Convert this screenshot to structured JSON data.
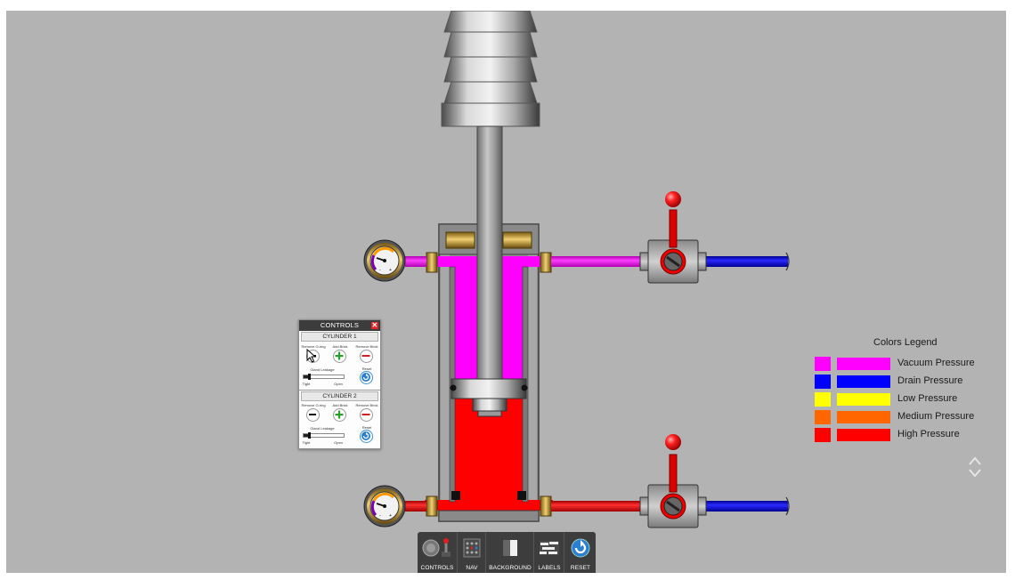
{
  "controls": {
    "title": "CONTROLS",
    "close_label": "✕",
    "cylinders": [
      {
        "title": "CYLINDER 1",
        "remove_oring_label": "Remove O-ring",
        "add_brick_label": "Add Brick",
        "remove_brick_label": "Remove Brick",
        "gland_leakage_label": "Gland Leakage",
        "reset_label": "Reset",
        "tight_label": "Tight",
        "open_label": "Open",
        "gland_leakage_level": 0.15
      },
      {
        "title": "CYLINDER 2",
        "remove_oring_label": "Remove O-ring",
        "add_brick_label": "Add Brick",
        "remove_brick_label": "Remove Brick",
        "gland_leakage_label": "Gland Leakage",
        "reset_label": "Reset",
        "tight_label": "Tight",
        "open_label": "Open",
        "gland_leakage_level": 0.15
      }
    ]
  },
  "legend": {
    "title": "Colors Legend",
    "items": [
      {
        "label": "Vacuum Pressure",
        "color": "#ff00ff"
      },
      {
        "label": "Drain Pressure",
        "color": "#0000ff"
      },
      {
        "label": "Low Pressure",
        "color": "#ffff00"
      },
      {
        "label": "Medium Pressure",
        "color": "#ff6600"
      },
      {
        "label": "High Pressure",
        "color": "#ff0000"
      }
    ]
  },
  "toolbar": {
    "items": [
      {
        "label": "CONTROLS",
        "icon": "controls-icon"
      },
      {
        "label": "NAV",
        "icon": "nav-icon"
      },
      {
        "label": "BACKGROUND",
        "icon": "background-icon"
      },
      {
        "label": "LABELS",
        "icon": "labels-icon"
      },
      {
        "label": "RESET",
        "icon": "reset-icon"
      }
    ]
  },
  "colors": {
    "canvas_bg": "#b3b3b3",
    "vacuum": "#ff00ff",
    "drain": "#0000ff",
    "high": "#ff0000",
    "steel": "#9a9a9a",
    "brass": "#c8a030"
  }
}
